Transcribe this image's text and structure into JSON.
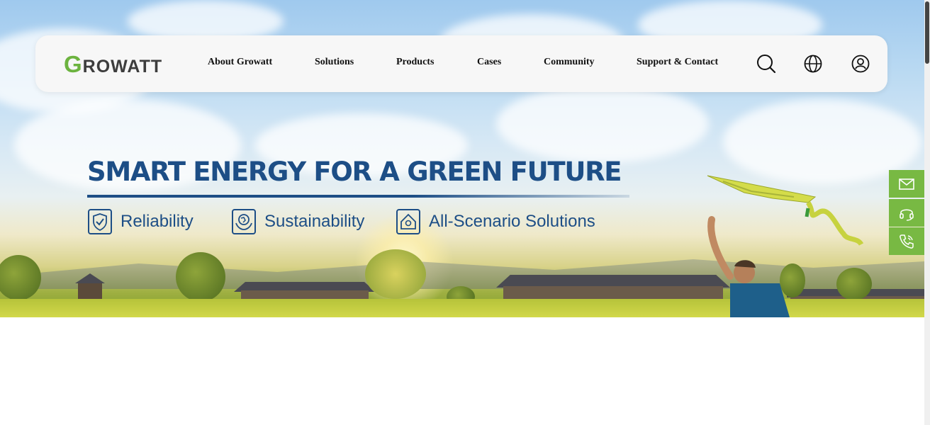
{
  "brand": {
    "logo_initial": "G",
    "logo_rest": "ROWATT",
    "accent_color": "#6cb33f",
    "text_color": "#1d4e86"
  },
  "nav": {
    "items": [
      {
        "label": "About Growatt"
      },
      {
        "label": "Solutions"
      },
      {
        "label": "Products"
      },
      {
        "label": "Cases"
      },
      {
        "label": "Community"
      },
      {
        "label": "Support & Contact"
      }
    ],
    "icons": [
      "search-icon",
      "globe-icon",
      "user-icon"
    ]
  },
  "hero": {
    "headline": "SMART ENERGY FOR A GREEN FUTURE",
    "features": [
      {
        "label": "Reliability",
        "icon": "shield-check-icon"
      },
      {
        "label": "Sustainability",
        "icon": "globe-hands-icon"
      },
      {
        "label": "All-Scenario Solutions",
        "icon": "home-icon"
      }
    ]
  },
  "side_actions": {
    "color": "#78b943",
    "items": [
      {
        "icon": "mail-icon"
      },
      {
        "icon": "headset-icon"
      },
      {
        "icon": "phone-icon"
      }
    ]
  }
}
